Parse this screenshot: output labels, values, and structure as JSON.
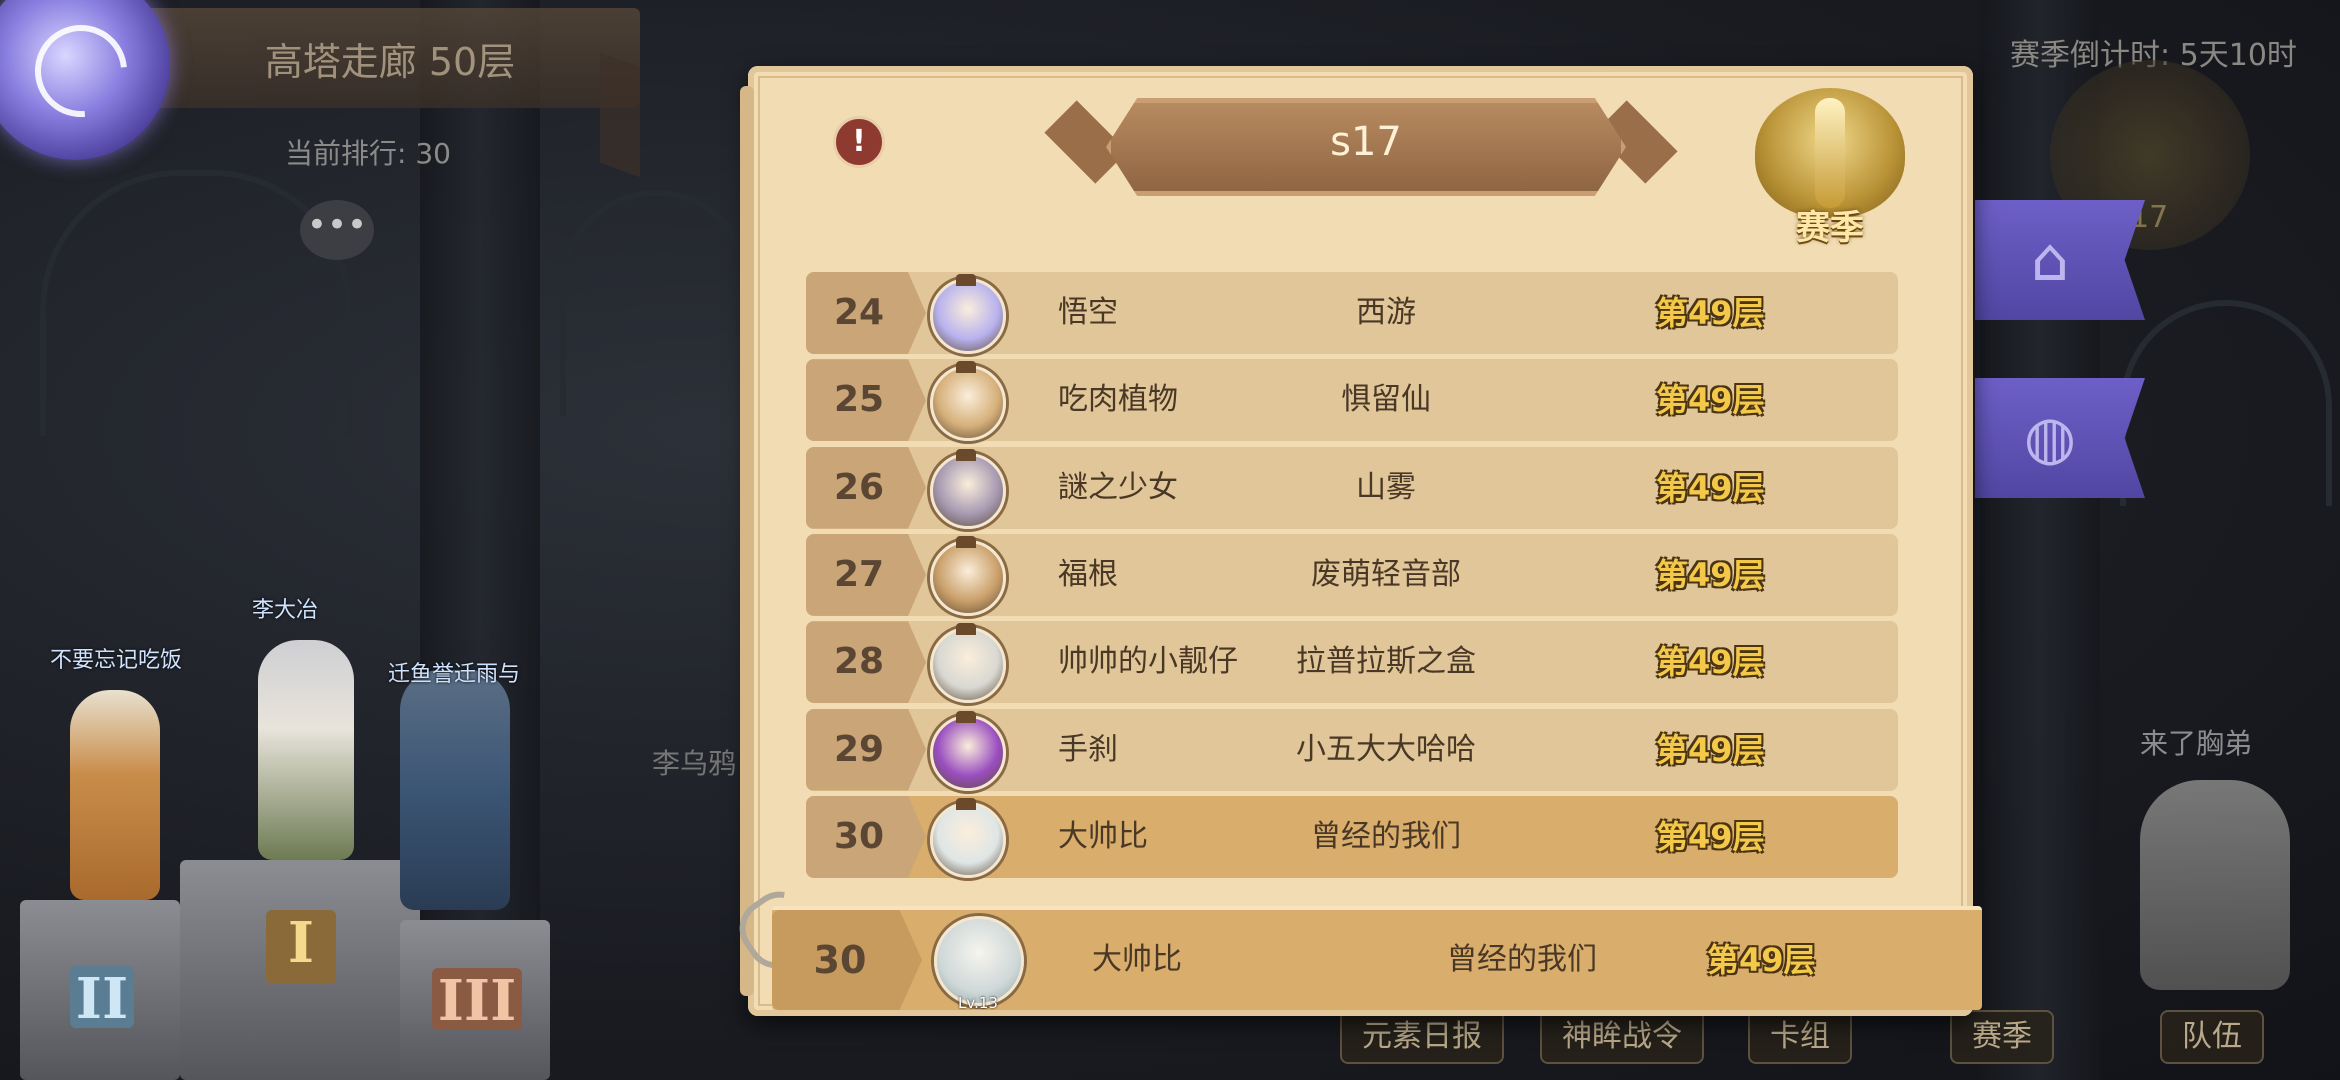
{
  "hud": {
    "floor_banner": "高塔走廊 50层",
    "current_rank": "当前排行: 30",
    "chat_icon": "chat-bubble-icon",
    "season_timer": "赛季倒计时: 5天10时",
    "bg_emblem_number": "17"
  },
  "podium": {
    "first": {
      "roman": "I",
      "name": "李大冶"
    },
    "second": {
      "roman": "II",
      "name": "不要忘记吃饭"
    },
    "third": {
      "roman": "III",
      "name": "迁鱼誉迁雨与"
    },
    "bg_names": [
      "李乌鸦",
      "来了胸弟"
    ]
  },
  "bottom_buttons": [
    "元素日报",
    "神眸战令",
    "卡组",
    "赛季",
    "队伍"
  ],
  "side_flags": [
    "castle-icon",
    "globe-icon"
  ],
  "panel": {
    "season_title": "s17",
    "season_badge": "赛季",
    "warn_icon": "exclamation-icon",
    "rows": [
      {
        "rank": "24",
        "name": "悟空",
        "guild": "西游",
        "floor": "第49层",
        "avatar_color": "#b8b2ee"
      },
      {
        "rank": "25",
        "name": "吃肉植物",
        "guild": "惧留仙",
        "floor": "第49层",
        "avatar_color": "#d6b07a"
      },
      {
        "rank": "26",
        "name": "謎之少女",
        "guild": "山雾",
        "floor": "第49层",
        "avatar_color": "#a79ab2"
      },
      {
        "rank": "27",
        "name": "福根",
        "guild": "废萌轻音部",
        "floor": "第49层",
        "avatar_color": "#caa06a"
      },
      {
        "rank": "28",
        "name": "帅帅的小靓仔",
        "guild": "拉普拉斯之盒",
        "floor": "第49层",
        "avatar_color": "#d8d8d2"
      },
      {
        "rank": "29",
        "name": "手刹",
        "guild": "小五大大哈哈",
        "floor": "第49层",
        "avatar_color": "#9a4fc0"
      },
      {
        "rank": "30",
        "name": "大帅比",
        "guild": "曾经的我们",
        "floor": "第49层",
        "avatar_color": "#dfe6e6",
        "me": true
      }
    ],
    "mine": {
      "rank": "30",
      "name": "大帅比",
      "guild": "曾经的我们",
      "floor": "第49层",
      "level": "Lv.13"
    }
  }
}
